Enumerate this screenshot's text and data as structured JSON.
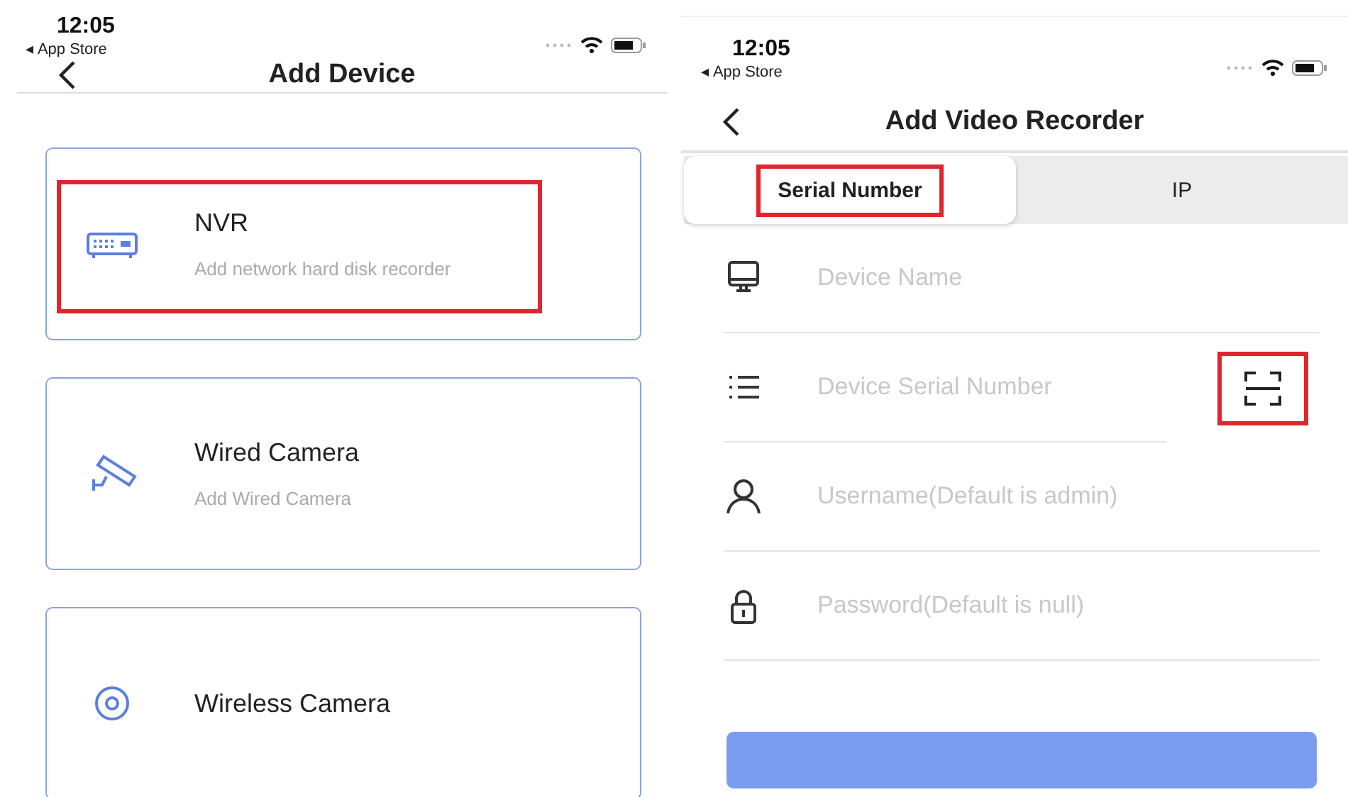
{
  "screens": [
    {
      "status_bar": {
        "time": "12:05",
        "back_app": "◂ App Store"
      },
      "nav": {
        "title": "Add Device"
      },
      "cards": [
        {
          "kind": "nvr",
          "title": "NVR",
          "subtitle": "Add network hard disk recorder",
          "highlighted": true
        },
        {
          "kind": "wired",
          "title": "Wired Camera",
          "subtitle": "Add Wired Camera",
          "highlighted": false
        },
        {
          "kind": "wireless",
          "title": "Wireless Camera",
          "highlighted": false
        }
      ]
    },
    {
      "status_bar": {
        "time": "12:05",
        "back_app": "◂ App Store"
      },
      "nav": {
        "title": "Add Video Recorder"
      },
      "tabs": [
        {
          "label": "Serial Number",
          "selected": true,
          "highlighted": true
        },
        {
          "label": "IP",
          "selected": false,
          "highlighted": false
        }
      ],
      "fields": [
        {
          "kind": "monitor",
          "placeholder": "Device Name"
        },
        {
          "kind": "list",
          "placeholder": "Device Serial Number",
          "scan": {
            "highlighted": true
          }
        },
        {
          "kind": "user",
          "placeholder": "Username(Default is admin)"
        },
        {
          "kind": "lock",
          "placeholder": "Password(Default is null)"
        }
      ],
      "submit_button": {
        "disabled": true
      }
    }
  ]
}
